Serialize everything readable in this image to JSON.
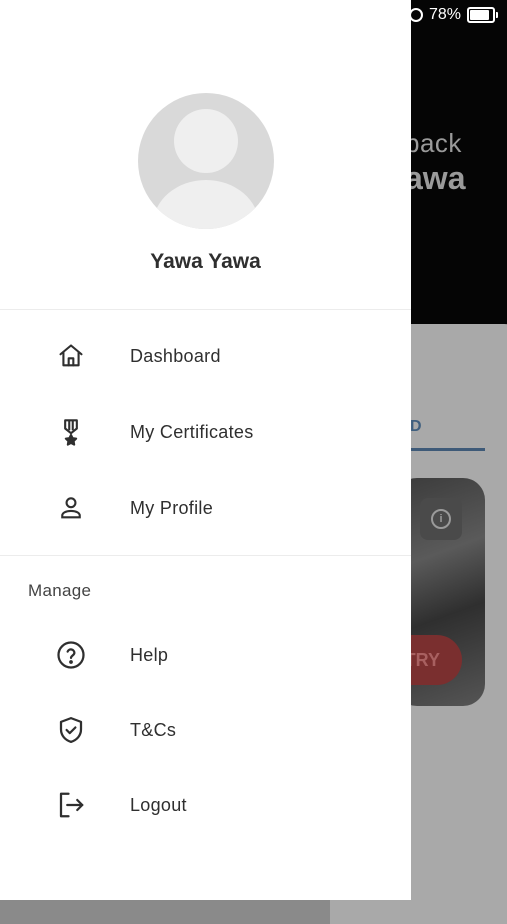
{
  "status_bar": {
    "battery": "78%"
  },
  "background": {
    "welcome_text": "back",
    "name_text": "awa",
    "tab_label": "D",
    "try_button": "TRY"
  },
  "drawer": {
    "user_name": "Yawa Yawa",
    "main_items": [
      {
        "label": "Dashboard",
        "icon": "home-icon"
      },
      {
        "label": "My Certificates",
        "icon": "certificate-icon"
      },
      {
        "label": "My Profile",
        "icon": "person-icon"
      }
    ],
    "section_title": "Manage",
    "manage_items": [
      {
        "label": "Help",
        "icon": "help-icon"
      },
      {
        "label": "T&Cs",
        "icon": "shield-check-icon"
      },
      {
        "label": "Logout",
        "icon": "logout-icon"
      }
    ]
  }
}
